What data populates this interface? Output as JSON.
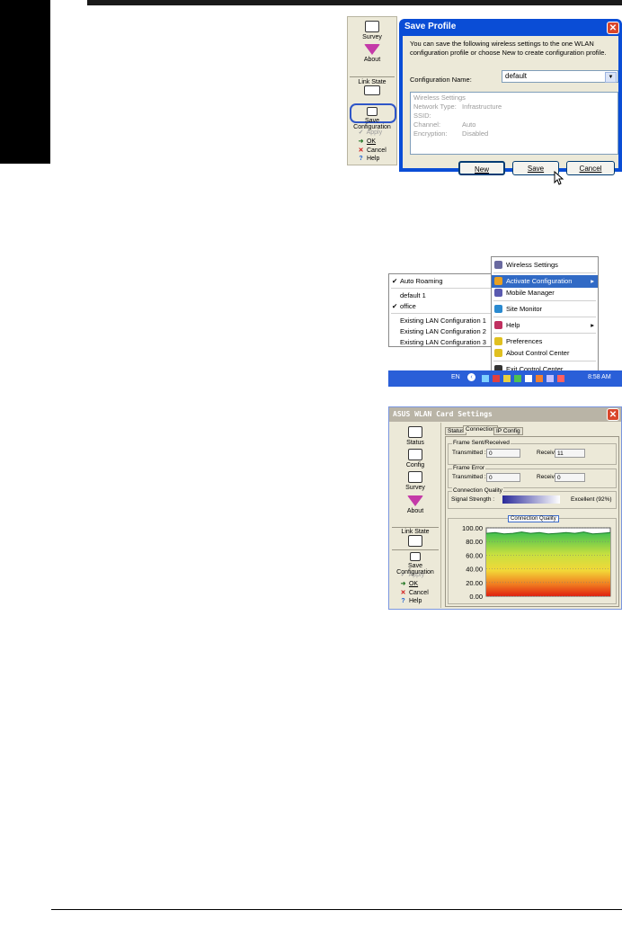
{
  "toolbar1": {
    "items": [
      "Survey",
      "About",
      "Link State",
      "Save Configuration"
    ],
    "commands": {
      "apply": "Apply",
      "ok": "OK",
      "cancel": "Cancel",
      "help": "Help"
    }
  },
  "save_profile": {
    "title": "Save Profile",
    "description": "You can save the following wireless settings to the one WLAN configuration profile or choose New to create configuration profile.",
    "config_name_label": "Configuration Name:",
    "config_name_value": "default",
    "settings": [
      {
        "label": "Wireless Settings",
        "value": ""
      },
      {
        "label": "Network Type:",
        "value": "Infrastructure"
      },
      {
        "label": "SSID:",
        "value": ""
      },
      {
        "label": "Channel:",
        "value": "Auto"
      },
      {
        "label": "Encryption:",
        "value": "Disabled"
      }
    ],
    "buttons": {
      "new": "New",
      "save": "Save",
      "cancel": "Cancel"
    }
  },
  "submenu": {
    "items": [
      "Auto Roaming",
      "default 1",
      "office",
      "Existing LAN Configuration 1",
      "Existing LAN Configuration 2",
      "Existing LAN Configuration 3"
    ]
  },
  "tray_menu": {
    "items": [
      "Wireless Settings",
      "Activate Configuration",
      "Mobile Manager",
      "Site Monitor",
      "Help",
      "Preferences",
      "About Control Center",
      "Exit Control Center"
    ]
  },
  "taskbar": {
    "lang": "EN",
    "time": "8:58 AM"
  },
  "card_settings": {
    "title": "ASUS WLAN Card Settings",
    "tabs": [
      "Status",
      "Connection",
      "IP Config"
    ],
    "side_items": [
      "Status",
      "Config",
      "Survey",
      "About",
      "Link State",
      "Save Configuration"
    ],
    "commands": {
      "apply": "Apply",
      "ok": "OK",
      "cancel": "Cancel",
      "help": "Help"
    },
    "frame_sent": {
      "legend": "Frame Sent/Received",
      "transmitted_label": "Transmitted :",
      "transmitted": "0",
      "received_label": "Received :",
      "received": "11"
    },
    "frame_error": {
      "legend": "Frame Error",
      "transmitted_label": "Transmitted :",
      "transmitted": "0",
      "received_label": "Received :",
      "received": "0"
    },
    "quality": {
      "legend": "Connection Quality",
      "signal_label": "Signal Strength :",
      "signal_text": "Excellent (92%)",
      "signal_pct": 92
    },
    "chart_caption": "Connection Quality"
  },
  "chart_data": {
    "type": "area",
    "title": "Connection Quality",
    "yticks": [
      "100.00",
      "80.00",
      "60.00",
      "40.00",
      "20.00",
      "0.00"
    ],
    "ylim": [
      0,
      100
    ],
    "series": [
      {
        "values": [
          92,
          93,
          91,
          92,
          94,
          92,
          93,
          91,
          92,
          93,
          92,
          94,
          91,
          92,
          93
        ]
      }
    ]
  }
}
